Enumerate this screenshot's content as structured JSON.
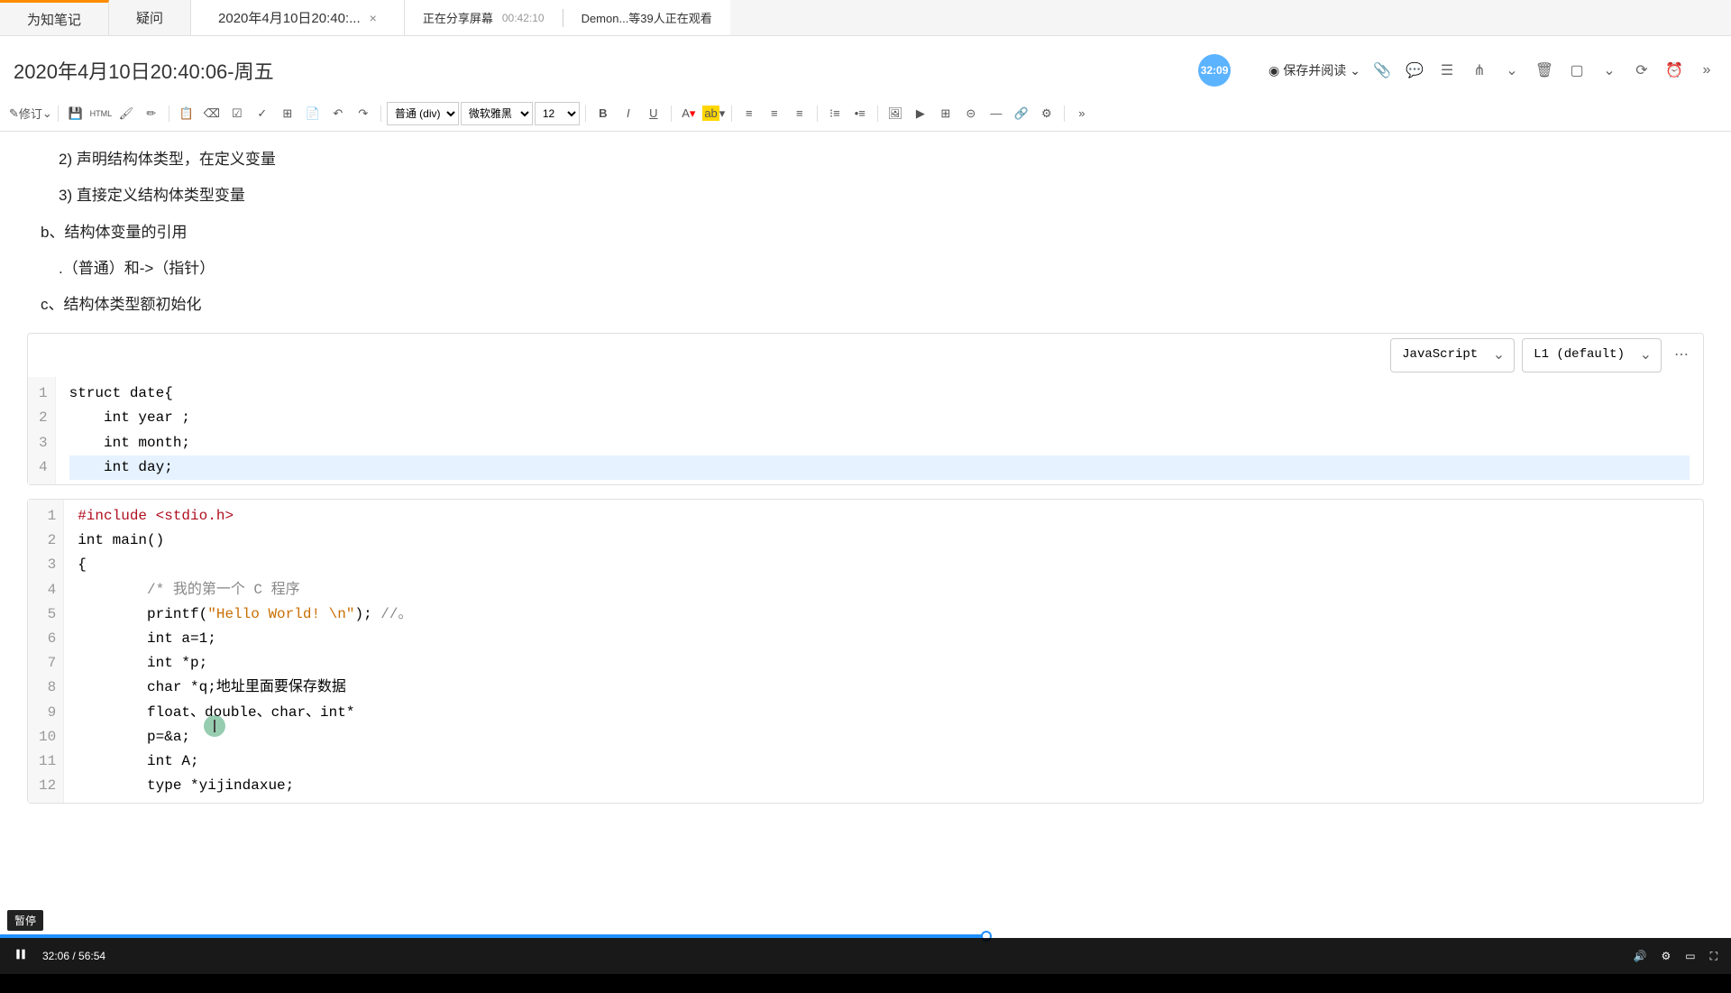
{
  "tabs": {
    "tab1": "为知笔记",
    "tab2": "疑问",
    "tab3": "2020年4月10日20:40:...",
    "close": "×"
  },
  "share": {
    "status": "正在分享屏幕",
    "timer": "00:42:10",
    "viewers": "Demon...等39人正在观看"
  },
  "badge": "32:09",
  "title": "2020年4月10日20:40:06-周五",
  "actions": {
    "save_read": "保存并阅读",
    "dropdown": "⌄"
  },
  "toolbar": {
    "edit": "修订",
    "html": "HTML",
    "format": "普通 (div)",
    "font": "微软雅黑",
    "size": "12",
    "bold": "B",
    "italic": "I",
    "underline": "U",
    "more": "»"
  },
  "content": {
    "line1": "2)  声明结构体类型，在定义变量",
    "line2": "3)  直接定义结构体类型变量",
    "line3": "b、结构体变量的引用",
    "line4": "  .（普通）和->（指针）",
    "line5": "c、结构体类型额初始化"
  },
  "code1": {
    "lang": "JavaScript",
    "tab": "L1 (default)",
    "lines": [
      "struct date{",
      "    int year ;",
      "    int month;",
      "    int day;"
    ]
  },
  "code2": {
    "lines": [
      {
        "n": "1",
        "text": "#include <stdio.h>",
        "parts": [
          {
            "c": "kw-include",
            "t": "#include"
          },
          {
            "c": "",
            "t": " "
          },
          {
            "c": "kw-include",
            "t": "<stdio.h>"
          }
        ]
      },
      {
        "n": "2",
        "text": "int main()"
      },
      {
        "n": "3",
        "text": "{"
      },
      {
        "n": "4",
        "text": "        /* 我的第一个 C 程序",
        "cls": "comment"
      },
      {
        "n": "5",
        "text": "        printf(\"Hello World! \\n\"); //。"
      },
      {
        "n": "6",
        "text": "        int a=1;"
      },
      {
        "n": "7",
        "text": "        int *p;"
      },
      {
        "n": "8",
        "text": "        char *q;地址里面要保存数据"
      },
      {
        "n": "9",
        "text": "        float、double、char、int*"
      },
      {
        "n": "10",
        "text": "        p=&a;"
      },
      {
        "n": "11",
        "text": "        int A;"
      },
      {
        "n": "12",
        "text": "        type *yijindaxue;"
      }
    ]
  },
  "video": {
    "pause_tip": "暂停",
    "time_current": "32:06",
    "time_total": "56:54"
  }
}
